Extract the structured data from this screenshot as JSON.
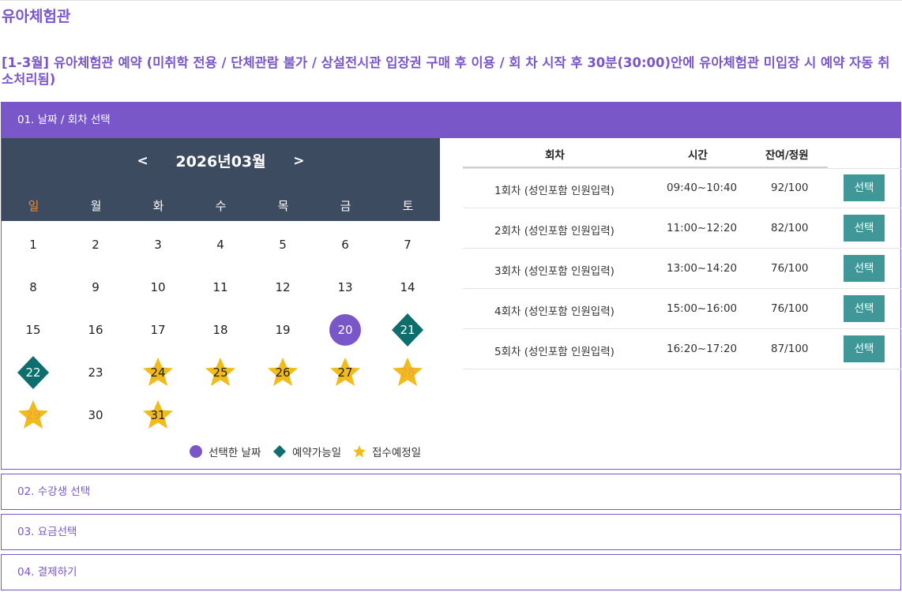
{
  "page": {
    "title": "유아체험관",
    "subtitle": "[1-3월] 유아체험관 예약 (미취학 전용 / 단체관람 불가 / 상설전시관 입장권 구매 후 이용 / 회 차 시작 후 30분(30:00)안에 유아체험관 미입장 시 예약 자동 취소처리됨)"
  },
  "steps": {
    "step1": "01. 날짜 / 회차 선택",
    "step2": "02. 수강생 선택",
    "step3": "03. 요금선택",
    "step4": "04. 결제하기"
  },
  "calendar": {
    "prev": "<",
    "next": ">",
    "month_label": "2026년03월",
    "weekdays": [
      "일",
      "월",
      "화",
      "수",
      "목",
      "금",
      "토"
    ],
    "days": [
      {
        "d": "1",
        "status": "none"
      },
      {
        "d": "2",
        "status": "none"
      },
      {
        "d": "3",
        "status": "none"
      },
      {
        "d": "4",
        "status": "none"
      },
      {
        "d": "5",
        "status": "none"
      },
      {
        "d": "6",
        "status": "none"
      },
      {
        "d": "7",
        "status": "none"
      },
      {
        "d": "8",
        "status": "none"
      },
      {
        "d": "9",
        "status": "none"
      },
      {
        "d": "10",
        "status": "none"
      },
      {
        "d": "11",
        "status": "none"
      },
      {
        "d": "12",
        "status": "none"
      },
      {
        "d": "13",
        "status": "none"
      },
      {
        "d": "14",
        "status": "none"
      },
      {
        "d": "15",
        "status": "none"
      },
      {
        "d": "16",
        "status": "none"
      },
      {
        "d": "17",
        "status": "none"
      },
      {
        "d": "18",
        "status": "none"
      },
      {
        "d": "19",
        "status": "none"
      },
      {
        "d": "20",
        "status": "selected"
      },
      {
        "d": "21",
        "status": "available"
      },
      {
        "d": "22",
        "status": "available"
      },
      {
        "d": "23",
        "status": "none"
      },
      {
        "d": "24",
        "status": "upcoming"
      },
      {
        "d": "25",
        "status": "upcoming"
      },
      {
        "d": "26",
        "status": "upcoming"
      },
      {
        "d": "27",
        "status": "upcoming"
      },
      {
        "d": "28",
        "status": "upcoming-muted"
      },
      {
        "d": "29",
        "status": "upcoming-muted"
      },
      {
        "d": "30",
        "status": "none"
      },
      {
        "d": "31",
        "status": "upcoming"
      }
    ],
    "legend": {
      "selected": "선택한 날짜",
      "available": "예약가능일",
      "upcoming": "접수예정일"
    }
  },
  "schedule": {
    "headers": {
      "round": "회차",
      "time": "시간",
      "remaining": "잔여/정원"
    },
    "select_label": "선택",
    "rows": [
      {
        "round": "1회차 (성인포함 인원입력)",
        "time": "09:40~10:40",
        "remaining": "92/100"
      },
      {
        "round": "2회차 (성인포함 인원입력)",
        "time": "11:00~12:20",
        "remaining": "82/100"
      },
      {
        "round": "3회차 (성인포함 인원입력)",
        "time": "13:00~14:20",
        "remaining": "76/100"
      },
      {
        "round": "4회차 (성인포함 인원입력)",
        "time": "15:00~16:00",
        "remaining": "76/100"
      },
      {
        "round": "5회차 (성인포함 인원입력)",
        "time": "16:20~17:20",
        "remaining": "87/100"
      }
    ]
  },
  "colors": {
    "accent": "#7a57c8",
    "calendar_header": "#3d4b60",
    "available": "#0e6e6e",
    "upcoming": "#f2bb1c",
    "button": "#3f9797",
    "sunday": "#f08a3a"
  }
}
